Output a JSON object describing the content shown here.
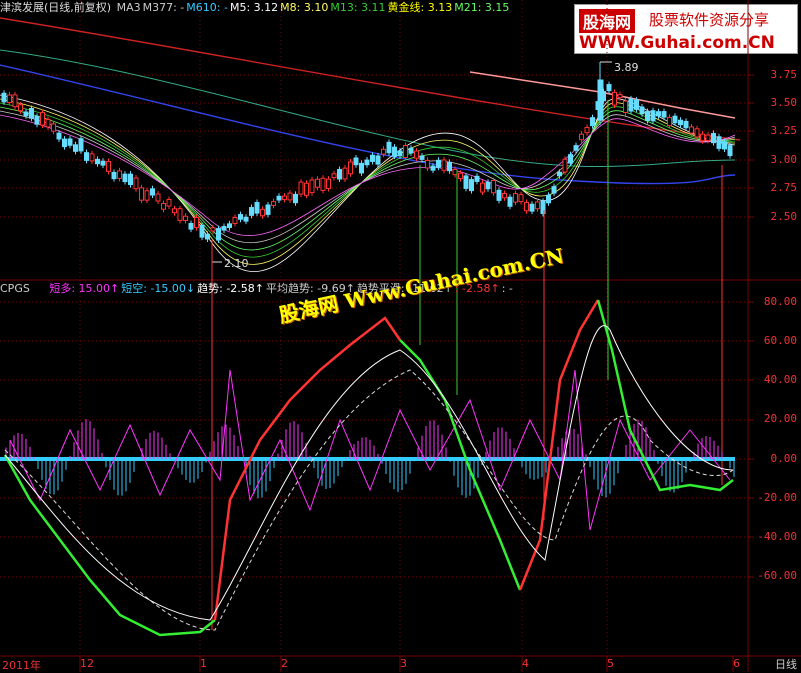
{
  "header": {
    "stock": "津滨发展(日线,前复权)",
    "ma_items": [
      {
        "text": "MA3",
        "color": "#cccccc"
      },
      {
        "text": "M377: -",
        "color": "#cccccc"
      },
      {
        "text": "M610: -",
        "color": "#33ccff"
      },
      {
        "text": "M5: 3.12",
        "color": "#ffffff"
      },
      {
        "text": "M8: 3.10",
        "color": "#ffff66"
      },
      {
        "text": "M13: 3.11",
        "color": "#33cc33"
      },
      {
        "text": "黄金线: 3.13",
        "color": "#ffff00"
      },
      {
        "text": "M21: 3.15",
        "color": "#66ff66"
      }
    ]
  },
  "indicator": {
    "name": "CPGS",
    "items": [
      {
        "text": "短多: 15.00↑",
        "color": "#ff33ff"
      },
      {
        "text": "短空: -15.00↓",
        "color": "#33ccff"
      },
      {
        "text": "趋势: -2.58↑",
        "color": "#ffffff"
      },
      {
        "text": "平均趋势: -9.69↑",
        "color": "#cccccc"
      },
      {
        "text": "趋势平滑: -11.62↑",
        "color": "#cccccc"
      },
      {
        "text": ": -2.58↑",
        "color": "#ff3333"
      },
      {
        "text": ": -",
        "color": "#cccccc"
      }
    ]
  },
  "price_axis": [
    "3.75",
    "3.50",
    "3.25",
    "3.00",
    "2.75",
    "2.50"
  ],
  "ind_axis": [
    "80.00",
    "60.00",
    "40.00",
    "20.00",
    "0.00",
    "-20.00",
    "-40.00",
    "-60.00"
  ],
  "price_labels": {
    "high": "3.89",
    "low": "2.10"
  },
  "dates": [
    {
      "text": "2011年",
      "cls": "yr"
    },
    {
      "text": "12",
      "cls": "d"
    },
    {
      "text": "1",
      "cls": "d"
    },
    {
      "text": "2",
      "cls": "d"
    },
    {
      "text": "3",
      "cls": "d"
    },
    {
      "text": "4",
      "cls": "d"
    },
    {
      "text": "5",
      "cls": "d"
    },
    {
      "text": "6",
      "cls": "d"
    }
  ],
  "period": "日线",
  "badge": {
    "logo": "股海网",
    "slogan": "股票软件资源分享",
    "url": "WWW.Guhai.com.CN"
  },
  "watermark": "股海网 Www.Guhai.com.CN",
  "colors": {
    "grid": "#7a0000",
    "up": "#ff3333",
    "down": "#33ccff",
    "pink": "#ff33ff"
  }
}
